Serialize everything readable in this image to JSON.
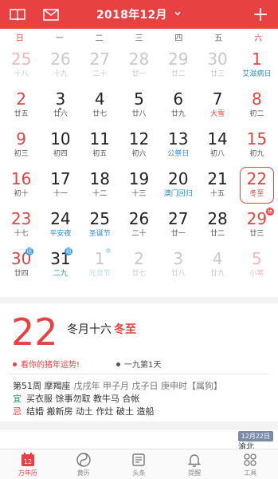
{
  "header": {
    "month": "2018年12月"
  },
  "weekdays": [
    "日",
    "一",
    "二",
    "三",
    "四",
    "五",
    "六"
  ],
  "days": [
    {
      "n": "25",
      "s": "十八"
    },
    {
      "n": "26",
      "s": "十九"
    },
    {
      "n": "27",
      "s": "二十"
    },
    {
      "n": "28",
      "s": "廿一"
    },
    {
      "n": "29",
      "s": "廿二"
    },
    {
      "n": "30",
      "s": "廿三"
    },
    {
      "n": "1",
      "s": "艾滋病日"
    },
    {
      "n": "2",
      "s": "廿五"
    },
    {
      "n": "3",
      "s": "廿六"
    },
    {
      "n": "4",
      "s": "廿七"
    },
    {
      "n": "5",
      "s": "廿八"
    },
    {
      "n": "6",
      "s": "廿九"
    },
    {
      "n": "7",
      "s": "大雪"
    },
    {
      "n": "8",
      "s": "初二"
    },
    {
      "n": "9",
      "s": "初三"
    },
    {
      "n": "10",
      "s": "初四"
    },
    {
      "n": "11",
      "s": "初五"
    },
    {
      "n": "12",
      "s": "初六"
    },
    {
      "n": "13",
      "s": "公祭日"
    },
    {
      "n": "14",
      "s": "初八"
    },
    {
      "n": "15",
      "s": "初九"
    },
    {
      "n": "16",
      "s": "初十"
    },
    {
      "n": "17",
      "s": "十一"
    },
    {
      "n": "18",
      "s": "十二"
    },
    {
      "n": "19",
      "s": "十三"
    },
    {
      "n": "20",
      "s": "澳门回归"
    },
    {
      "n": "21",
      "s": "十五"
    },
    {
      "n": "22",
      "s": "冬至"
    },
    {
      "n": "23",
      "s": "十七"
    },
    {
      "n": "24",
      "s": "平安夜"
    },
    {
      "n": "25",
      "s": "圣诞节"
    },
    {
      "n": "26",
      "s": "二十"
    },
    {
      "n": "27",
      "s": "廿一"
    },
    {
      "n": "28",
      "s": "廿二"
    },
    {
      "n": "29",
      "s": "廿三"
    },
    {
      "n": "30",
      "s": "廿四"
    },
    {
      "n": "31",
      "s": "二九"
    },
    {
      "n": "1",
      "s": "元旦节"
    },
    {
      "n": "2",
      "s": "廿七"
    },
    {
      "n": "3",
      "s": "廿八"
    },
    {
      "n": "4",
      "s": "廿九"
    },
    {
      "n": "5",
      "s": "小寒"
    }
  ],
  "badges": {
    "rest": "休",
    "work": "班"
  },
  "info": {
    "day": "22",
    "lunar": "冬月十六",
    "term": "冬至",
    "pig": "看你的猪年运势!",
    "nine": "一九第1天",
    "week": "第51周 摩羯座",
    "ganzhi": "戊戌年 甲子月 戊子日 庚申时【属狗】",
    "yi_label": "宜",
    "yi": "买衣服 馀事勿取 教牛马 合帐",
    "ji_label": "忌",
    "ji": "结婚 搬新房 动土 作灶 破土 造船"
  },
  "card2": {
    "tag": "12月22日",
    "loc": "渝北 "
  },
  "tabs": [
    {
      "label": "万年历",
      "icon": "calendar-icon"
    },
    {
      "label": "黄历",
      "icon": "yin-yang-icon"
    },
    {
      "label": "头条",
      "icon": "news-icon"
    },
    {
      "label": "提醒",
      "icon": "bell-icon"
    },
    {
      "label": "工具",
      "icon": "grid-icon"
    }
  ],
  "colors": {
    "accent": "#e84141",
    "blue": "#2a8bd6"
  }
}
